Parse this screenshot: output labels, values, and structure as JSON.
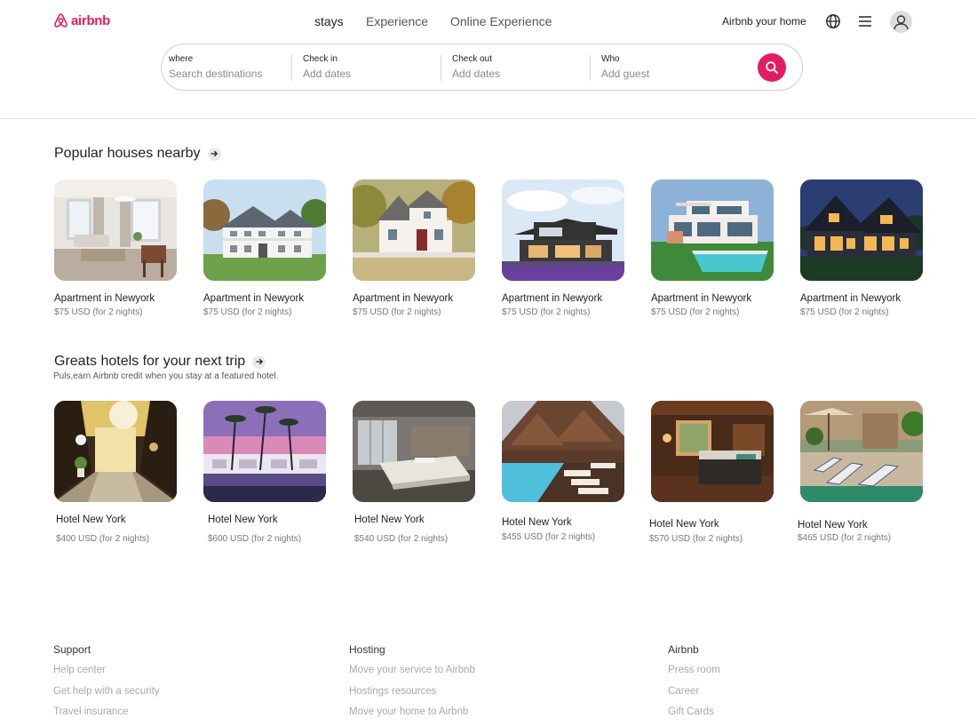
{
  "brand": {
    "name": "airbnb",
    "color": "#e31c5f"
  },
  "nav": {
    "stays": "stays",
    "experience": "Experience",
    "online": "Online Experience"
  },
  "header_right": {
    "host": "Airbnb your home",
    "globe_icon": "globe-icon",
    "menu_icon": "menu-icon",
    "avatar_icon": "user-icon"
  },
  "search": {
    "where": {
      "label": "where",
      "placeholder": "Search destinations"
    },
    "checkin": {
      "label": "Check in",
      "placeholder": "Add dates"
    },
    "checkout": {
      "label": "Check out",
      "placeholder": "Add dates"
    },
    "who": {
      "label": "Who",
      "placeholder": "Add guest"
    },
    "button_icon": "search-icon"
  },
  "popular": {
    "title": "Popular houses nearby",
    "cards": [
      {
        "title": "Apartment  in Newyork",
        "price": "$75 USD (for 2 nights)"
      },
      {
        "title": "Apartment  in Newyork",
        "price": "$75 USD (for 2 nights)"
      },
      {
        "title": "Apartment  in Newyork",
        "price": "$75 USD (for 2 nights)"
      },
      {
        "title": "Apartment  in Newyork",
        "price": "$75 USD (for 2 nights)"
      },
      {
        "title": "Apartment  in Newyork",
        "price": "$75 USD (for 2 nights)"
      },
      {
        "title": "Apartment  in Newyork",
        "price": "$75 USD (for 2 nights)"
      }
    ]
  },
  "hotels": {
    "title": "Greats  hotels for your next trip",
    "subtitle": "Puls,earn Airbnb credit when you stay at a featured hotel.",
    "cards": [
      {
        "title": "Hotel New York",
        "price": "$400 USD (for 2 nights)"
      },
      {
        "title": "Hotel New York",
        "price": "$600 USD (for 2 nights)"
      },
      {
        "title": "Hotel New York",
        "price": "$540 USD (for 2 nights)"
      },
      {
        "title": "Hotel New York",
        "price": "$455 USD (for 2 nights)"
      },
      {
        "title": "Hotel New York",
        "price": "$570 USD (for 2 nights)"
      },
      {
        "title": "Hotel New York",
        "price": "$465 USD (for 2 nights)"
      }
    ]
  },
  "footer": {
    "support": {
      "heading": "Support",
      "links": [
        "Help center",
        "Get help with a security",
        "Travel insurance"
      ]
    },
    "hosting": {
      "heading": "Hosting",
      "links": [
        "Move your  service to Airbnb",
        "Hostings resources",
        "Move your  home to Airbnb"
      ]
    },
    "airbnb": {
      "heading": "Airbnb",
      "links": [
        "Press room",
        "Career",
        "Gift Cards"
      ]
    }
  }
}
